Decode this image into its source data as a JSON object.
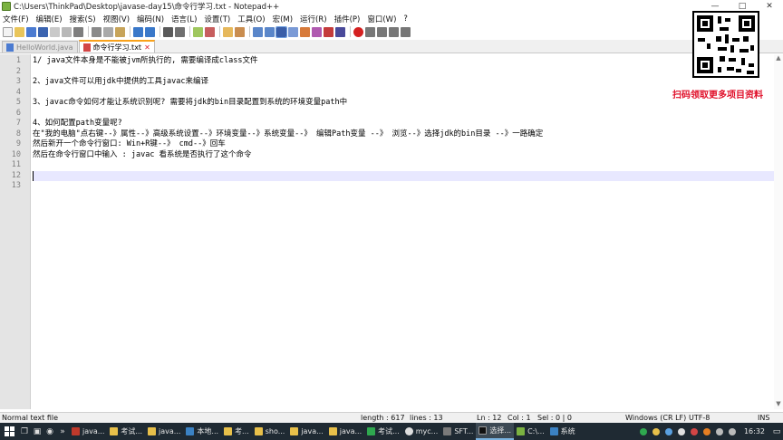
{
  "window": {
    "title": "C:\\Users\\ThinkPad\\Desktop\\javase-day15\\命令行学习.txt - Notepad++",
    "minimize": "—",
    "maximize": "□",
    "close": "✕"
  },
  "menu": [
    "文件(F)",
    "编辑(E)",
    "搜索(S)",
    "视图(V)",
    "编码(N)",
    "语言(L)",
    "设置(T)",
    "工具(O)",
    "宏(M)",
    "运行(R)",
    "插件(P)",
    "窗口(W)",
    "?"
  ],
  "tabs": [
    {
      "label": "HelloWorld.java",
      "active": false,
      "saved": true
    },
    {
      "label": "命令行学习.txt",
      "active": true,
      "saved": false
    }
  ],
  "editor": {
    "line_numbers": [
      "1",
      "2",
      "3",
      "4",
      "5",
      "6",
      "7",
      "8",
      "9",
      "10",
      "11",
      "12",
      "13"
    ],
    "lines": [
      "1/ java文件本身是不能被jvm所执行的, 需要编译成class文件",
      "",
      "2、java文件可以用jdk中提供的工具javac来编译",
      "",
      "3、javac命令如何才能让系统识别呢? 需要将jdk的bin目录配置到系统的环境变量path中",
      "",
      "4、如何配置path变量呢?",
      "在\"我的电脑\"点右键--》属性--》高级系统设置--》环境变量--》系统变量--》 编辑Path变量 --》 浏览--》选择jdk的bin目录 --》一路确定",
      "然后新开一个命令行窗口:  Win+R键--》 cmd--》回车",
      "然后在命令行窗口中输入 : javac 看系统是否执行了这个命令",
      "",
      "",
      ""
    ],
    "current_line": 12
  },
  "promo_text": "扫码领取更多项目资料",
  "status": {
    "file_type": "Normal text file",
    "length": "length : 617",
    "lines": "lines : 13",
    "ln": "Ln : 12",
    "col": "Col : 1",
    "sel": "Sel : 0 | 0",
    "eol": "Windows (CR LF)",
    "encoding": "UTF-8",
    "mode": "INS"
  },
  "taskbar": {
    "items": [
      {
        "label": "java...",
        "color": "#c0392b"
      },
      {
        "label": "考试...",
        "color": "#e8c04a"
      },
      {
        "label": "java...",
        "color": "#e8c04a"
      },
      {
        "label": "本地...",
        "color": "#3b82c4"
      },
      {
        "label": "考...",
        "color": "#e8c04a"
      },
      {
        "label": "sho...",
        "color": "#e8c04a"
      },
      {
        "label": "java...",
        "color": "#e8c04a"
      },
      {
        "label": "java...",
        "color": "#e8c04a"
      },
      {
        "label": "考试...",
        "color": "#2fa84f"
      },
      {
        "label": "myc...",
        "color": "#dddddd"
      },
      {
        "label": "SFT...",
        "color": "#7a7a7a"
      },
      {
        "label": "选择...",
        "color": "#222222",
        "active": true
      },
      {
        "label": "C:\\...",
        "color": "#7bb241"
      },
      {
        "label": "系统",
        "color": "#3b82c4"
      }
    ],
    "clock": "16:32"
  }
}
